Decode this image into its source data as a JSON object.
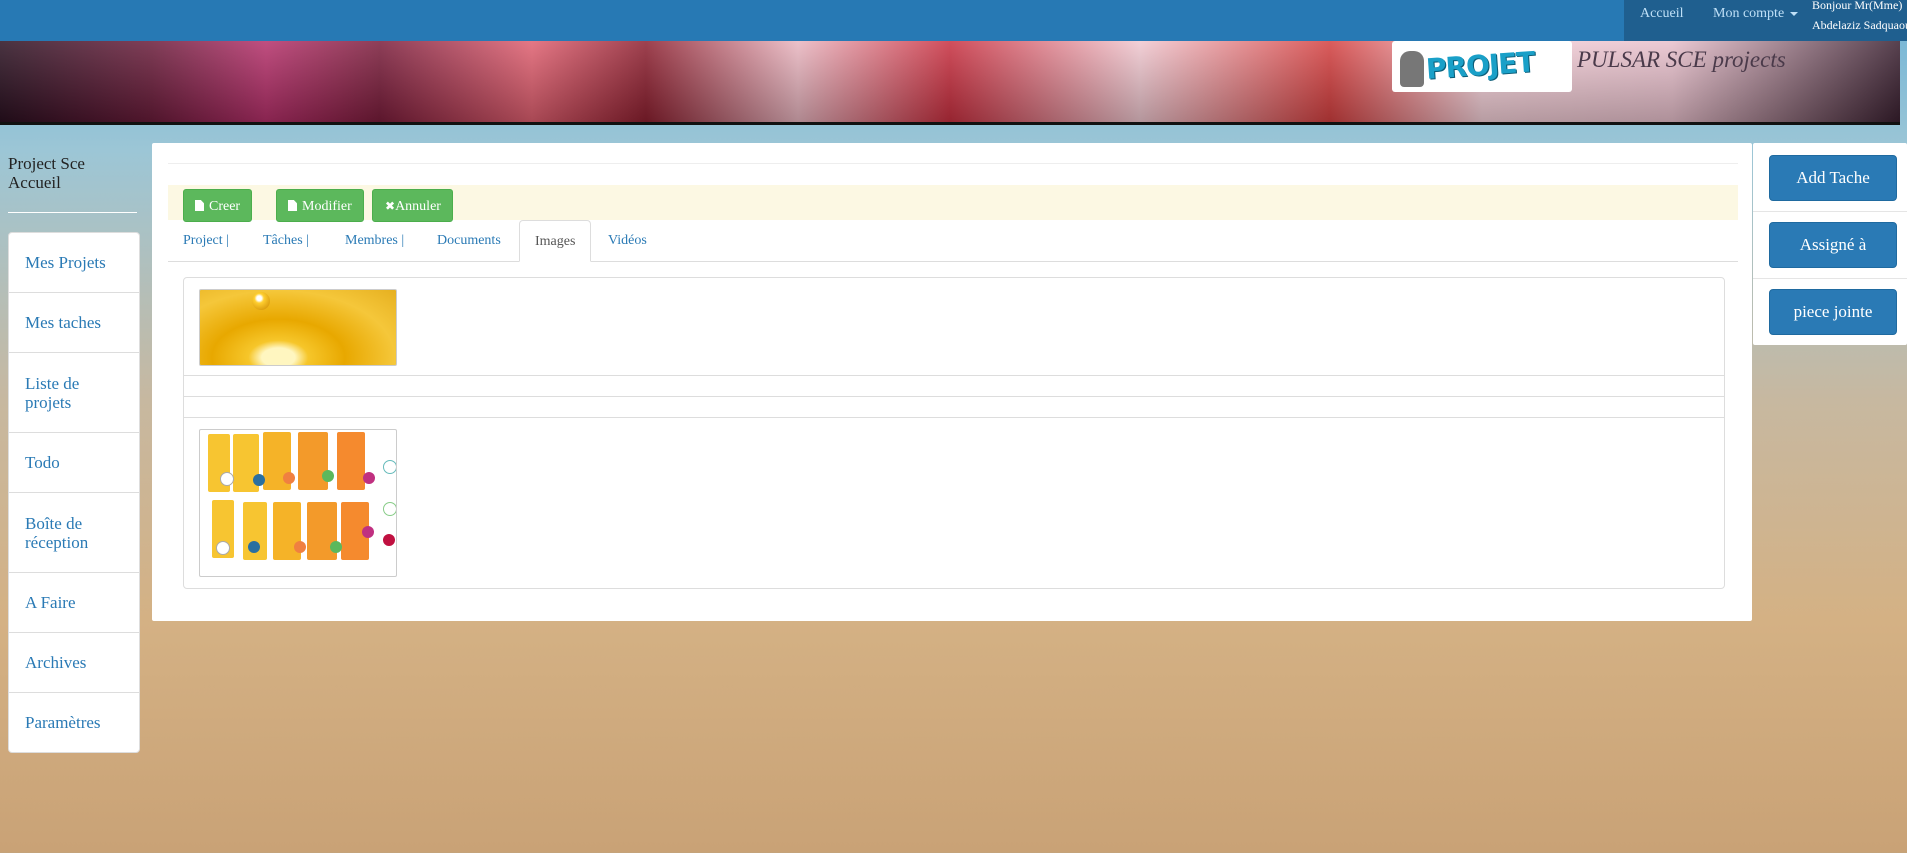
{
  "nav": {
    "home": "Accueil",
    "account": "Mon compte",
    "greeting_line1": "Bonjour Mr(Mme)",
    "greeting_line2": "Abdelaziz Sadquaoui"
  },
  "banner": {
    "logo_text": "PROJET",
    "brand": "PULSAR SCE projects"
  },
  "sidebar": {
    "title": "Project Sce Accueil",
    "items": [
      {
        "label": "Mes Projets"
      },
      {
        "label": "Mes taches"
      },
      {
        "label": "Liste de projets"
      },
      {
        "label": "Todo"
      },
      {
        "label": "Boîte de réception"
      },
      {
        "label": "A Faire"
      },
      {
        "label": "Archives"
      },
      {
        "label": "Paramètres"
      }
    ]
  },
  "toolbar": {
    "create": "Creer",
    "edit": "Modifier",
    "cancel": "Annuler"
  },
  "tabs": [
    {
      "label": "Project |"
    },
    {
      "label": "Tâches |"
    },
    {
      "label": "Membres |"
    },
    {
      "label": "Documents"
    },
    {
      "label": "Images"
    },
    {
      "label": "Vidéos"
    }
  ],
  "active_tab": "Images",
  "right_panel": {
    "add_task": "Add Tache",
    "assigned": "Assigné à",
    "attachment": "piece jointe"
  },
  "colors": {
    "nav": "#2779b4",
    "primary": "#2a7ab5",
    "success": "#5cb85c",
    "toolbar_bg": "#fcf8e3"
  }
}
